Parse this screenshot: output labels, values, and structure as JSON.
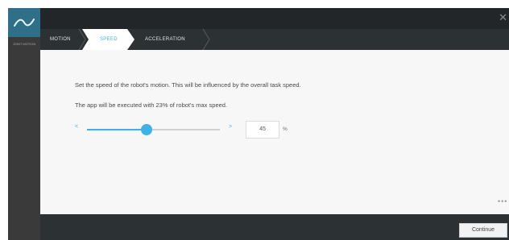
{
  "sidebar": {
    "label": "JOINT MOTION",
    "icon": "curve-icon"
  },
  "window": {
    "close_icon": "close-icon",
    "close_glyph": "✕"
  },
  "steps": [
    {
      "label": "MOTION",
      "active": false
    },
    {
      "label": "SPEED",
      "active": true
    },
    {
      "label": "ACCELERATION",
      "active": false
    }
  ],
  "content": {
    "line1": "Set the speed of the robot's motion. This will be influenced by the overall task speed.",
    "line2": "The app will be executed with 23% of robot's max speed.",
    "slider": {
      "left_glyph": "<",
      "right_glyph": ">",
      "value": "45",
      "fraction": 0.45,
      "unit": "%"
    },
    "more_glyph": "•••"
  },
  "footer": {
    "continue_label": "Continue"
  },
  "colors": {
    "accent": "#3fb0e8",
    "rail": "#3a3a3a",
    "icon_box": "#2f6f88",
    "topbar": "#222628",
    "stepbar": "#2c3133",
    "content_bg": "#f7f7f7"
  }
}
